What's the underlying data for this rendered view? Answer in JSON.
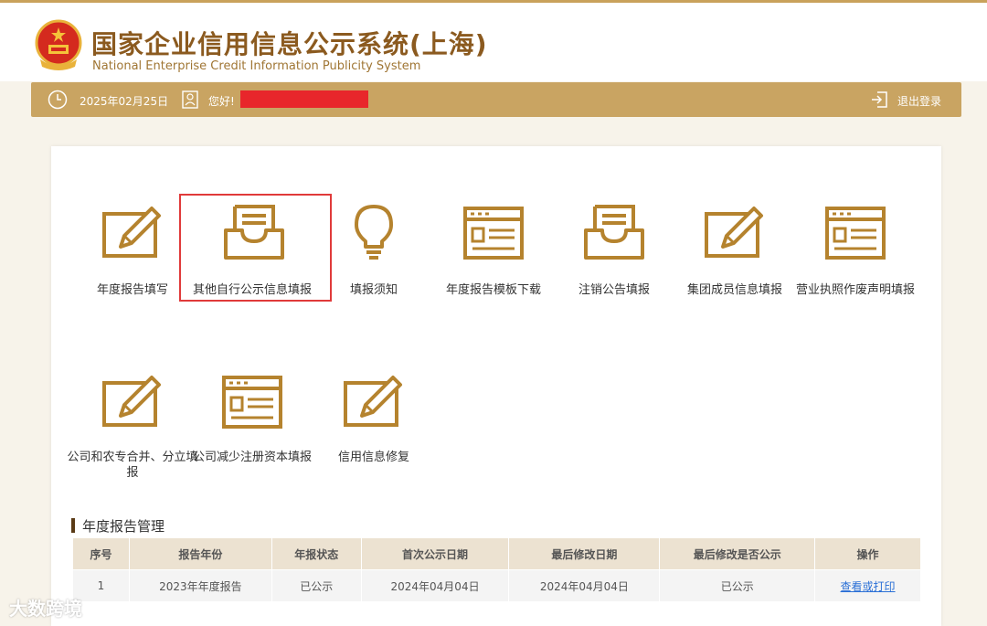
{
  "header": {
    "title_cn": "国家企业信用信息公示系统(上海)",
    "title_en": "National Enterprise Credit Information Publicity System"
  },
  "topbar": {
    "date": "2025年02月25日",
    "greeting": "您好!",
    "logout": "退出登录"
  },
  "functions": [
    {
      "label": "年度报告填写",
      "icon": "edit-icon"
    },
    {
      "label": "其他自行公示信息填报",
      "icon": "inbox-icon"
    },
    {
      "label": "填报须知",
      "icon": "lightbulb-icon"
    },
    {
      "label": "年度报告模板下载",
      "icon": "template-icon"
    },
    {
      "label": "注销公告填报",
      "icon": "inbox-icon"
    },
    {
      "label": "集团成员信息填报",
      "icon": "edit-icon"
    },
    {
      "label": "营业执照作废声明填报",
      "icon": "template-icon"
    },
    {
      "label": "公司和农专合并、分立填报",
      "icon": "edit-icon"
    },
    {
      "label": "公司减少注册资本填报",
      "icon": "template-icon"
    },
    {
      "label": "信用信息修复",
      "icon": "edit-icon"
    }
  ],
  "report_section": {
    "title": "年度报告管理",
    "columns": [
      "序号",
      "报告年份",
      "年报状态",
      "首次公示日期",
      "最后修改日期",
      "最后修改是否公示",
      "操作"
    ],
    "rows": [
      {
        "no": "1",
        "year": "2023年年度报告",
        "status": "已公示",
        "first_date": "2024年04月04日",
        "last_date": "2024年04月04日",
        "last_public": "已公示",
        "action": "查看或打印"
      }
    ]
  },
  "watermark": "大数跨境",
  "colors": {
    "gold": "#c9a462",
    "icon_gold": "#b5832e",
    "brown_title": "#8b5a1f",
    "highlight_red": "#e03a3a"
  }
}
